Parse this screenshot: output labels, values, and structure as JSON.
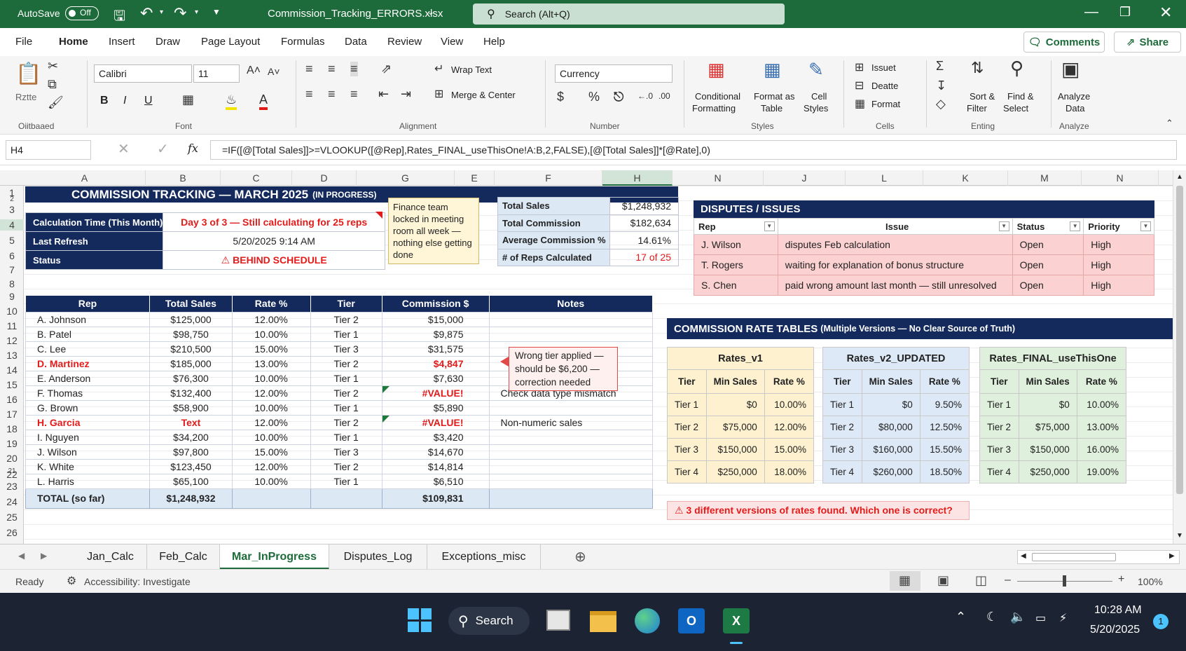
{
  "titlebar": {
    "autosave_label": "AutoSave",
    "autosave_state": "Off",
    "filename": "Commission_Tracking_ERRORS.xlsx",
    "search_placeholder": "Search (Alt+Q)"
  },
  "menu": {
    "items": [
      "File",
      "Home",
      "Insert",
      "Draw",
      "Page Layout",
      "Formulas",
      "Data",
      "Review",
      "View",
      "Help"
    ],
    "active": "Home",
    "comments_label": "Comments",
    "share_label": "Share"
  },
  "ribbon": {
    "clipboard": {
      "paste_label": "Rztte",
      "group": "Oiitbaaed"
    },
    "font": {
      "name": "Calibri",
      "size": "11",
      "group": "Font",
      "bold": "B",
      "italic": "I",
      "underline": "U"
    },
    "alignment": {
      "wrap": "Wrap Text",
      "merge": "Merge & Center",
      "group": "Alignment"
    },
    "number": {
      "format": "Currency",
      "group": "Number"
    },
    "styles": {
      "conditional": "Conditional",
      "conditional2": "Formatting",
      "format_as": "Format as",
      "format_as2": "Table",
      "cell": "Cell",
      "cell2": "Styles",
      "group": "Styles"
    },
    "cells": {
      "insert": "Issuet",
      "delete": "Deatte",
      "format": "Format",
      "group": "Cells"
    },
    "editing": {
      "sort": "Sort &",
      "sort2": "Filter",
      "find": "Find &",
      "find2": "Select",
      "group": "Enting"
    },
    "analyze": {
      "label1": "Analyze",
      "label2": "Data",
      "group": "Analyze"
    }
  },
  "formula_bar": {
    "cell_ref": "H4",
    "fx": "fx",
    "formula": "=IF([@[Total Sales]]>=VLOOKUP([@Rep],Rates_FINAL_useThisOne!A:B,2,FALSE),[@[Total Sales]]*[@Rate],0)"
  },
  "columns": [
    {
      "label": "A",
      "w": 174
    },
    {
      "label": "B",
      "w": 107
    },
    {
      "label": "C",
      "w": 102
    },
    {
      "label": "D",
      "w": 92
    },
    {
      "label": "G",
      "w": 140
    },
    {
      "label": "E",
      "w": 57
    },
    {
      "label": "F",
      "w": 154
    },
    {
      "label": "H",
      "w": 100
    },
    {
      "label": "N",
      "w": 130
    },
    {
      "label": "J",
      "w": 117
    },
    {
      "label": "L",
      "w": 111
    },
    {
      "label": "K",
      "w": 121
    },
    {
      "label": "M",
      "w": 105
    },
    {
      "label": "N",
      "w": 110
    }
  ],
  "rows": [
    "1",
    "2",
    "3",
    "4",
    "5",
    "6",
    "7",
    "8",
    "9",
    "10",
    "11",
    "12",
    "13",
    "14",
    "15",
    "16",
    "17",
    "18",
    "19",
    "20",
    "21",
    "22",
    "23",
    "24",
    "25",
    "26"
  ],
  "title": {
    "main": "COMMISSION TRACKING — MARCH 2025",
    "sub": "(IN PROGRESS)"
  },
  "info": [
    {
      "key": "Calculation Time (This Month)",
      "value": "Day 3 of 3 — Still calculating for 25 reps",
      "red": true
    },
    {
      "key": "Last Refresh",
      "value": "5/20/2025   9:14 AM",
      "red": false
    },
    {
      "key": "Status",
      "value": "BEHIND SCHEDULE",
      "red": true
    }
  ],
  "finance_note": "Finance team locked in meeting room all week — nothing else getting done",
  "summary": [
    {
      "key": "Total Sales",
      "value": "$1,248,932",
      "red": false
    },
    {
      "key": "Total Commission",
      "value": "$182,634",
      "red": false
    },
    {
      "key": "Average Commission %",
      "value": "14.61%",
      "red": false
    },
    {
      "key": "# of Reps Calculated",
      "value": "17 of 25",
      "red": true
    }
  ],
  "main_table": {
    "headers": [
      "Rep",
      "Total Sales",
      "Rate %",
      "Tier",
      "Commission $",
      "Notes"
    ],
    "rows": [
      {
        "rep": "A. Johnson",
        "sales": "$125,000",
        "rate": "12.00%",
        "tier": "Tier 2",
        "comm": "$15,000",
        "notes": "",
        "flag": ""
      },
      {
        "rep": "B. Patel",
        "sales": "$98,750",
        "rate": "10.00%",
        "tier": "Tier 1",
        "comm": "$9,875",
        "notes": "",
        "flag": ""
      },
      {
        "rep": "C. Lee",
        "sales": "$210,500",
        "rate": "15.00%",
        "tier": "Tier 3",
        "comm": "$31,575",
        "notes": "",
        "flag": ""
      },
      {
        "rep": "D. Martinez",
        "sales": "$185,000",
        "rate": "13.00%",
        "tier": "Tier 2",
        "comm": "$4,847",
        "notes": "",
        "flag": "red"
      },
      {
        "rep": "E. Anderson",
        "sales": "$76,300",
        "rate": "10.00%",
        "tier": "Tier 1",
        "comm": "$7,630",
        "notes": "",
        "flag": ""
      },
      {
        "rep": "F. Thomas",
        "sales": "$132,400",
        "rate": "12.00%",
        "tier": "Tier 2",
        "comm": "#VALUE!",
        "notes": "Check data type mismatch",
        "flag": "err"
      },
      {
        "rep": "G. Brown",
        "sales": "$58,900",
        "rate": "10.00%",
        "tier": "Tier 1",
        "comm": "$5,890",
        "notes": "",
        "flag": ""
      },
      {
        "rep": "H. Garcia",
        "sales": "Text",
        "rate": "12.00%",
        "tier": "Tier 2",
        "comm": "#VALUE!",
        "notes": "Non-numeric sales",
        "flag": "red"
      },
      {
        "rep": "I. Nguyen",
        "sales": "$34,200",
        "rate": "10.00%",
        "tier": "Tier 1",
        "comm": "$3,420",
        "notes": "",
        "flag": ""
      },
      {
        "rep": "J. Wilson",
        "sales": "$97,800",
        "rate": "15.00%",
        "tier": "Tier 3",
        "comm": "$14,670",
        "notes": "",
        "flag": ""
      },
      {
        "rep": "K. White",
        "sales": "$123,450",
        "rate": "12.00%",
        "tier": "Tier 2",
        "comm": "$14,814",
        "notes": "",
        "flag": ""
      },
      {
        "rep": "L. Harris",
        "sales": "$65,100",
        "rate": "10.00%",
        "tier": "Tier 1",
        "comm": "$6,510",
        "notes": "",
        "flag": ""
      }
    ],
    "total": {
      "label": "TOTAL (so far)",
      "sales": "$1,248,932",
      "comm": "$109,831"
    }
  },
  "wrong_tier_note": "Wrong tier applied — should be $6,200 — correction needed",
  "disputes": {
    "title": "DISPUTES / ISSUES",
    "headers": [
      "Rep",
      "Issue",
      "Status",
      "Priority"
    ],
    "rows": [
      {
        "rep": "J. Wilson",
        "issue": "disputes Feb calculation",
        "status": "Open",
        "priority": "High"
      },
      {
        "rep": "T. Rogers",
        "issue": "waiting for explanation of bonus structure",
        "status": "Open",
        "priority": "High"
      },
      {
        "rep": "S. Chen",
        "issue": "paid wrong amount last month — still unresolved",
        "status": "Open",
        "priority": "High"
      }
    ]
  },
  "rate_tables": {
    "title": "COMMISSION RATE TABLES",
    "subtitle": "(Multiple Versions — No Clear Source of Truth)",
    "headers": [
      "Tier",
      "Min Sales",
      "Rate %"
    ],
    "tables": [
      {
        "name": "Rates_v1",
        "bg": "#fdf1cf",
        "rows": [
          [
            "Tier 1",
            "$0",
            "10.00%"
          ],
          [
            "Tier 2",
            "$75,000",
            "12.00%"
          ],
          [
            "Tier 3",
            "$150,000",
            "15.00%"
          ],
          [
            "Tier 4",
            "$250,000",
            "18.00%"
          ]
        ]
      },
      {
        "name": "Rates_v2_UPDATED",
        "bg": "#dde9f7",
        "rows": [
          [
            "Tier 1",
            "$0",
            "9.50%"
          ],
          [
            "Tier 2",
            "$80,000",
            "12.50%"
          ],
          [
            "Tier 3",
            "$160,000",
            "15.50%"
          ],
          [
            "Tier 4",
            "$260,000",
            "18.50%"
          ]
        ]
      },
      {
        "name": "Rates_FINAL_useThisOne",
        "bg": "#dff1dc",
        "rows": [
          [
            "Tier 1",
            "$0",
            "10.00%"
          ],
          [
            "Tier 2",
            "$75,000",
            "13.00%"
          ],
          [
            "Tier 3",
            "$150,000",
            "16.00%"
          ],
          [
            "Tier 4",
            "$250,000",
            "19.00%"
          ]
        ]
      }
    ],
    "warning": "3 different versions of rates found.  Which one is correct?"
  },
  "sheet_tabs": [
    "Jan_Calc",
    "Feb_Calc",
    "Mar_InProgress",
    "Disputes_Log",
    "Exceptions_misc"
  ],
  "active_sheet": "Mar_InProgress",
  "status": {
    "ready": "Ready",
    "accessibility": "Accessibility: Investigate",
    "zoom": "100%"
  },
  "taskbar": {
    "search": "Search",
    "time": "10:28 AM",
    "date": "5/20/2025",
    "badge": "1"
  },
  "colors": {
    "excel_green": "#1d6b3a",
    "navy": "#142a5c",
    "error_red": "#e21b1b"
  }
}
